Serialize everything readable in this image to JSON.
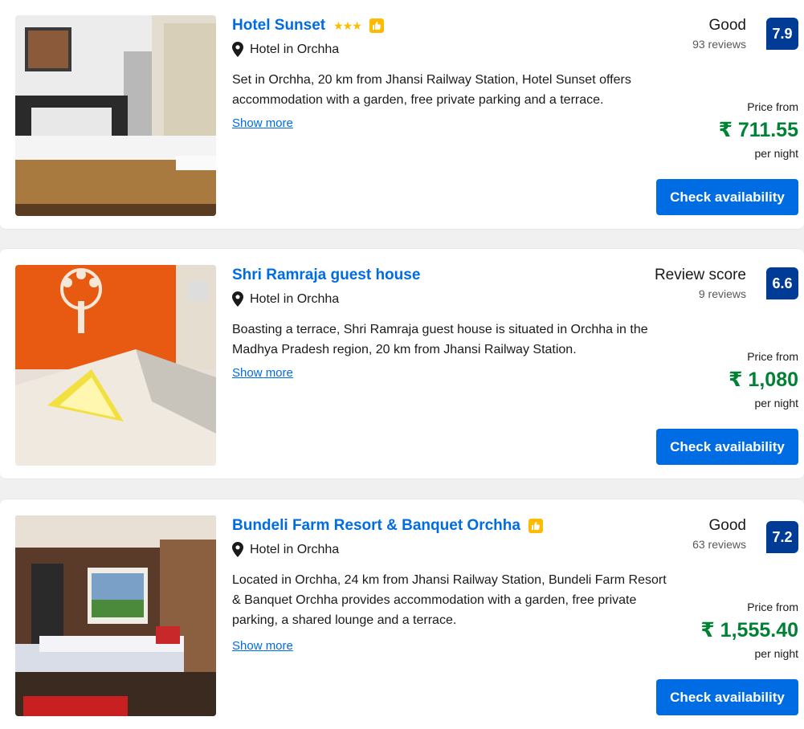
{
  "listings": [
    {
      "name": "Hotel Sunset",
      "stars": "★★★",
      "has_thumbs": true,
      "location": "Hotel in Orchha",
      "description": "Set in Orchha, 20 km from Jhansi Railway Station, Hotel Sunset offers accommodation with a garden, free private parking and a terrace.",
      "show_more": "Show more",
      "review_label": "Good",
      "review_count": "93 reviews",
      "score": "7.9",
      "price_from": "Price from",
      "price": "₹ 711.55",
      "per_night": "per night",
      "cta": "Check availability"
    },
    {
      "name": "Shri Ramraja guest house",
      "stars": "",
      "has_thumbs": false,
      "location": "Hotel in Orchha",
      "description": "Boasting a terrace, Shri Ramraja guest house is situated in Orchha in the Madhya Pradesh region, 20 km from Jhansi Railway Station.",
      "show_more": "Show more",
      "review_label": "Review score",
      "review_count": "9 reviews",
      "score": "6.6",
      "price_from": "Price from",
      "price": "₹ 1,080",
      "per_night": "per night",
      "cta": "Check availability"
    },
    {
      "name": "Bundeli Farm Resort & Banquet Orchha",
      "stars": "",
      "has_thumbs": true,
      "location": "Hotel in Orchha",
      "description": "Located in Orchha, 24 km from Jhansi Railway Station, Bundeli Farm Resort & Banquet Orchha provides accommodation with a garden, free private parking, a shared lounge and a terrace.",
      "show_more": "Show more",
      "review_label": "Good",
      "review_count": "63 reviews",
      "score": "7.2",
      "price_from": "Price from",
      "price": "₹ 1,555.40",
      "per_night": "per night",
      "cta": "Check availability"
    }
  ],
  "colors": {
    "link_blue": "#006ce4",
    "score_navy": "#003b95",
    "price_green": "#008234",
    "star_yellow": "#febb02"
  },
  "icons": [
    "map-pin-icon",
    "thumbs-up-icon",
    "star-icon"
  ]
}
